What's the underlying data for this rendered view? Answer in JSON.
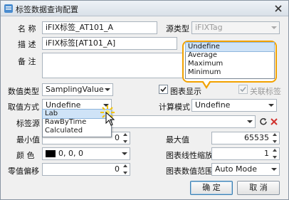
{
  "window": {
    "title": "标签数据查询配置"
  },
  "fields": {
    "name_label": "名  称",
    "name_value": "iFIX标签_AT101_A",
    "source_type_label": "源类型",
    "source_type_value": "iFIXTag",
    "desc_label": "描  述",
    "desc_value": "iFIX标签[AT101_A]",
    "remark_label": "备  注",
    "remark_value": "",
    "data_type_label": "数值类型",
    "data_type_value": "SamplingValue",
    "show_chart_label": "图表显示",
    "link_tag_label": "关联标签",
    "fetch_mode_label": "取值方式",
    "fetch_mode_value": "Undefine",
    "calc_mode_label": "计算模式",
    "calc_mode_value": "Undefine",
    "tag_source_label": "标签源",
    "tag_source_value": "",
    "min_label": "最小值",
    "min_value": "0",
    "max_label": "最大值",
    "max_value": "65535",
    "color_label": "颜  色",
    "color_value": "0, 0, 0",
    "scale_label": "图表线性缩放",
    "scale_value": "1",
    "offset_label": "零值偏移",
    "offset_value": "0",
    "range_label": "图表数值范围",
    "range_value": "Auto Mode"
  },
  "fetch_dropdown": {
    "options": [
      "Lab",
      "RawByTime",
      "Calculated"
    ],
    "highlighted": "Lab"
  },
  "calc_dropdown": {
    "options": [
      "Undefine",
      "Average",
      "Maximum",
      "Minimum"
    ],
    "highlighted": "Undefine"
  },
  "buttons": {
    "ok": "确 定",
    "cancel": "取 消"
  },
  "colors": {
    "callout": "#f2a200",
    "accent": "#3c7fb1",
    "swatch": "#000000"
  },
  "state": {
    "show_chart_checked": true,
    "link_tag_checked": true,
    "link_tag_enabled": false
  }
}
